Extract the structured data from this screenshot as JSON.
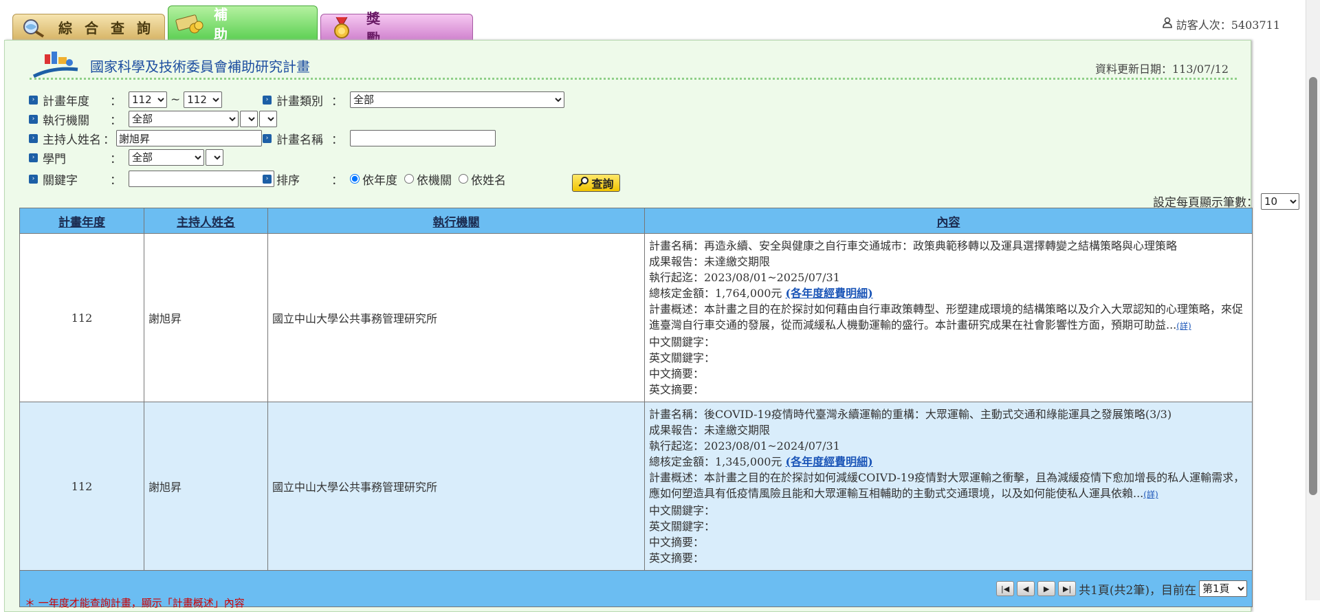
{
  "tabs": [
    {
      "label": "綜合查詢"
    },
    {
      "label": "補助"
    },
    {
      "label": "獎勵"
    }
  ],
  "visitors": {
    "text": "訪客人次：5403711"
  },
  "header": {
    "title": "國家科學及技術委員會補助研究計畫",
    "updated": "資料更新日期：113/07/12"
  },
  "form": {
    "year_label": "計畫年度",
    "year_from": "112",
    "year_sep": "~",
    "year_to": "112",
    "type_label": "計畫類別",
    "type_value": "全部",
    "org_label": "執行機關",
    "org_value": "全部",
    "pi_label": "主持人姓名",
    "pi_value": "謝旭昇",
    "proj_name_label": "計畫名稱",
    "proj_name_value": "",
    "field_label": "學門",
    "field_value": "全部",
    "keyword_label": "關鍵字",
    "keyword_value": "",
    "sort_label": "排序",
    "sort_options": [
      "依年度",
      "依機關",
      "依姓名"
    ],
    "sort_selected": "依年度",
    "search_button": "查詢",
    "colon": "："
  },
  "pagesize": {
    "label": "設定每頁顯示筆數：",
    "value": "10"
  },
  "table": {
    "headers": [
      "計畫年度",
      "主持人姓名",
      "執行機關",
      "內容"
    ],
    "rows": [
      {
        "year": "112",
        "pi": "謝旭昇",
        "org": "國立中山大學公共事務管理研究所",
        "name": "計畫名稱：再造永續、安全與健康之自行車交通城市：政策典範移轉以及運具選擇轉變之結構策略與心理策略",
        "report": "成果報告：未達繳交期限",
        "period": "執行起迄：2023/08/01~2025/07/31",
        "amount": "總核定金額：1,764,000元",
        "amount_link": "(各年度經費明細)",
        "summary": "計畫概述：本計畫之目的在於探討如何藉由自行車政策轉型、形塑建成環境的結構策略以及介入大眾認知的心理策略，來促進臺灣自行車交通的發展，從而減緩私人機動運輸的盛行。本計畫研究成果在社會影響性方面，預期可助益...",
        "more": "(詳)",
        "kw_zh": "中文關鍵字：",
        "kw_en": "英文關鍵字：",
        "abs_zh": "中文摘要：",
        "abs_en": "英文摘要："
      },
      {
        "year": "112",
        "pi": "謝旭昇",
        "org": "國立中山大學公共事務管理研究所",
        "name": "計畫名稱：後COVID-19疫情時代臺灣永續運輸的重構：大眾運輸、主動式交通和綠能運具之發展策略(3/3)",
        "report": "成果報告：未達繳交期限",
        "period": "執行起迄：2023/08/01~2024/07/31",
        "amount": "總核定金額：1,345,000元",
        "amount_link": "(各年度經費明細)",
        "summary": "計畫概述：本計畫之目的在於探討如何減緩COIVD-19疫情對大眾運輸之衝擊，且為減緩疫情下愈加增長的私人運輸需求，應如何塑造具有低疫情風險且能和大眾運輸互相輔助的主動式交通環境，以及如何能使私人運具依賴...",
        "more": "(詳)",
        "kw_zh": "中文關鍵字：",
        "kw_en": "英文關鍵字：",
        "abs_zh": "中文摘要：",
        "abs_en": "英文摘要："
      }
    ]
  },
  "pager": {
    "summary": "共1頁(共2筆)，目前在",
    "current": "第1頁"
  },
  "note": "＊ 一年度才能查詢計畫，顯示「計畫概述」內容"
}
